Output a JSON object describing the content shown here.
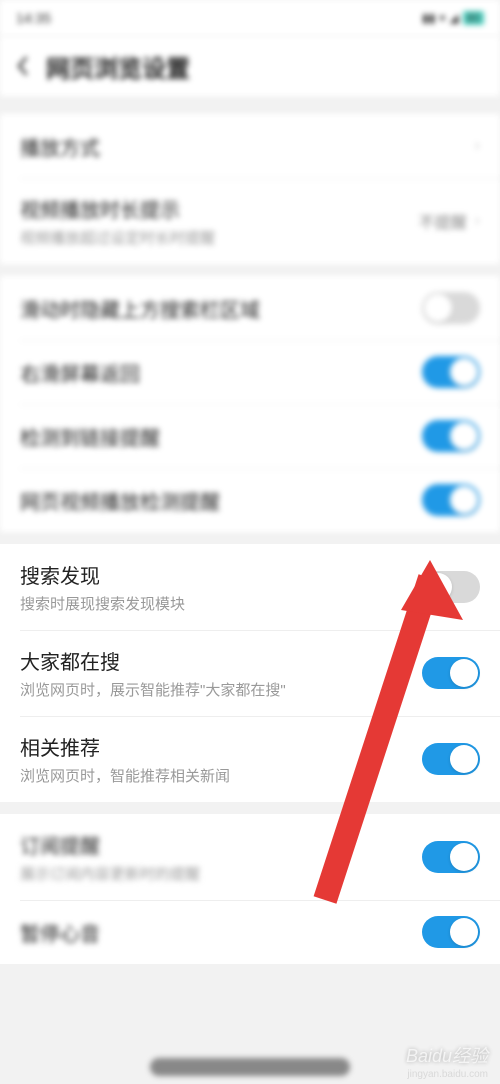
{
  "status": {
    "time": "14:35",
    "battery": "80"
  },
  "header": {
    "title": "网页浏览设置"
  },
  "group1": {
    "r1_title": "播放方式",
    "r2_title": "视频播放时长提示",
    "r2_sub": "视频播放超过设定时长时提醒",
    "r2_value": "不提醒"
  },
  "group2": {
    "r1_title": "滑动时隐藏上方搜索栏区域",
    "r2_title": "右滑屏幕返回",
    "r3_title": "检测到链接提醒",
    "r4_title": "网页视频播放检测提醒"
  },
  "group3": {
    "r1_title": "搜索发现",
    "r1_sub": "搜索时展现搜索发现模块",
    "r2_title": "大家都在搜",
    "r2_sub": "浏览网页时，展示智能推荐\"大家都在搜\"",
    "r3_title": "相关推荐",
    "r3_sub": "浏览网页时，智能推荐相关新闻"
  },
  "group4": {
    "r1_title": "订阅提醒",
    "r1_sub": "展示订阅内容更新时的提醒",
    "r2_title": "暂停心音"
  },
  "watermark": {
    "main": "Baidu经验",
    "sub": "jingyan.baidu.com"
  }
}
